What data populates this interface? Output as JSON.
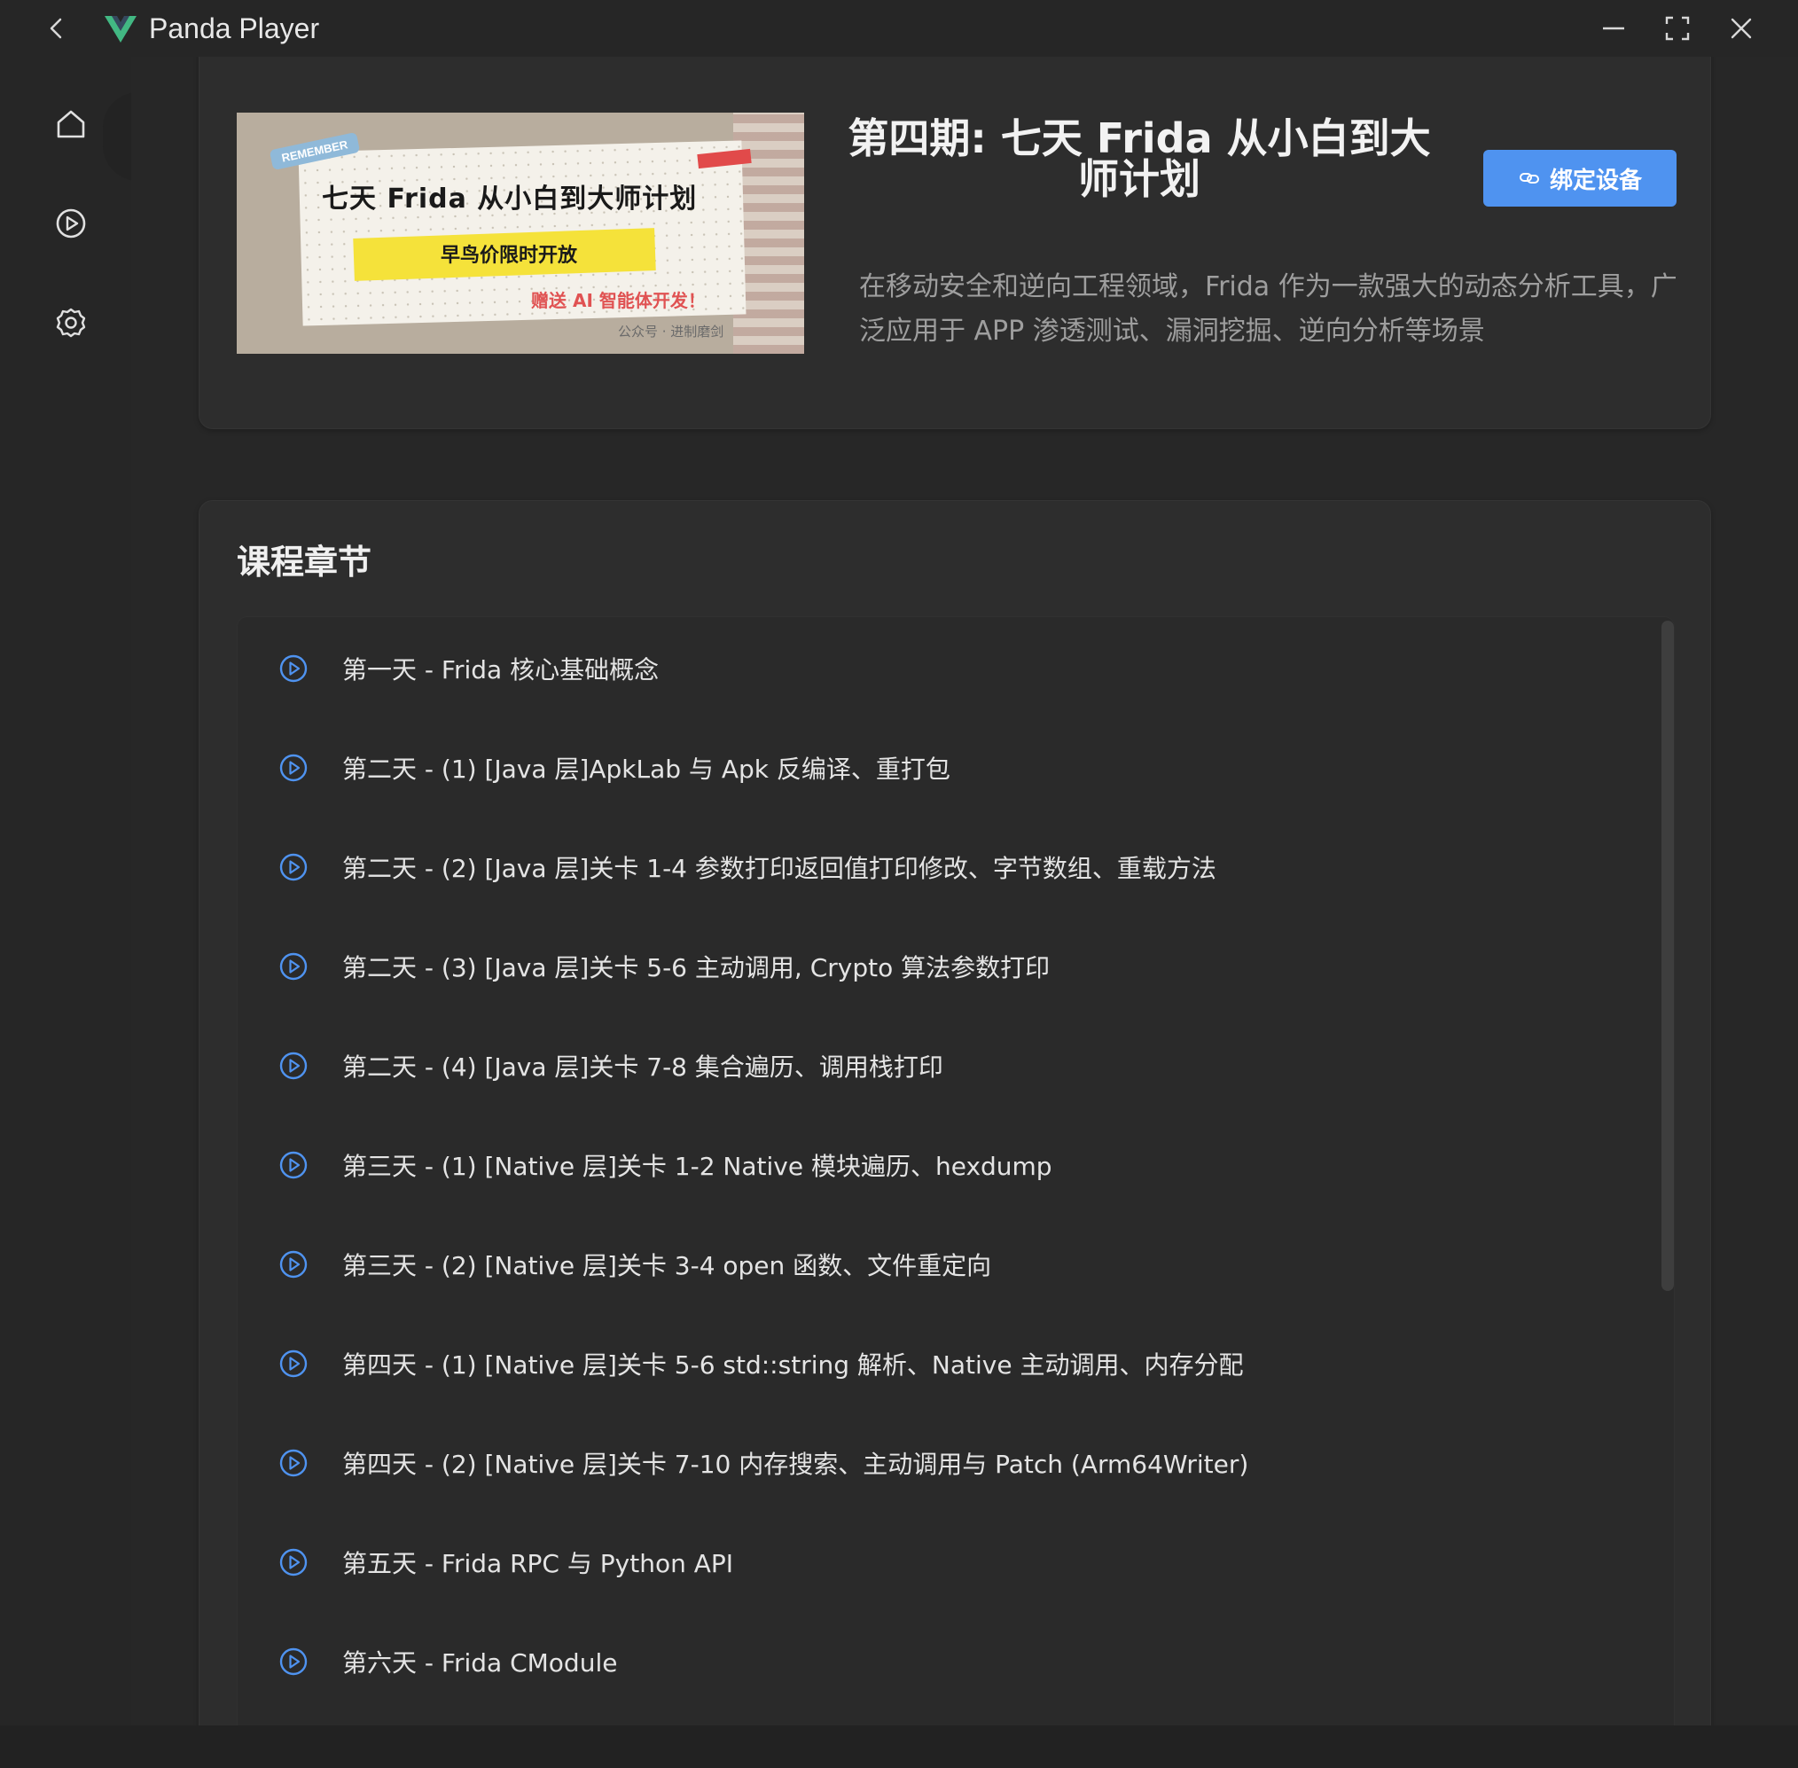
{
  "titlebar": {
    "app_title": "Panda Player",
    "logo_color": "#42b883",
    "back_icon": "chevron-left-icon",
    "minimize_icon": "minimize-icon",
    "maximize_icon": "fullscreen-icon",
    "close_icon": "close-icon"
  },
  "sidebar": {
    "items": [
      {
        "name": "home",
        "icon": "home-icon"
      },
      {
        "name": "player",
        "icon": "play-circle-icon"
      },
      {
        "name": "settings",
        "icon": "gear-icon"
      }
    ]
  },
  "course": {
    "cover": {
      "tag": "REMEMBER",
      "title": "七天 Frida 从小白到大师计划",
      "subtitle": "早鸟价限时开放",
      "gift": "赠送 AI 智能体开发！",
      "watermark": "公众号 · 进制磨剑"
    },
    "title": "第四期: 七天 Frida 从小白到大师计划",
    "bind_button": "绑定设备",
    "description": "在移动安全和逆向工程领域，Frida 作为一款强大的动态分析工具，广泛应用于 APP 渗透测试、漏洞挖掘、逆向分析等场景",
    "accent_color": "#4f93f0"
  },
  "chapters": {
    "heading": "课程章节",
    "items": [
      "第一天 - Frida 核心基础概念",
      "第二天 - (1) [Java 层]ApkLab 与 Apk 反编译、重打包",
      "第二天 - (2) [Java 层]关卡 1-4 参数打印返回值打印修改、字节数组、重载方法",
      "第二天 - (3) [Java 层]关卡 5-6 主动调用, Crypto 算法参数打印",
      "第二天 - (4) [Java 层]关卡 7-8 集合遍历、调用栈打印",
      "第三天 - (1) [Native 层]关卡 1-2 Native 模块遍历、hexdump",
      "第三天 - (2) [Native 层]关卡 3-4 open 函数、文件重定向",
      "第四天 - (1) [Native 层]关卡 5-6 std::string 解析、Native 主动调用、内存分配",
      "第四天 - (2) [Native 层]关卡 7-10 内存搜索、主动调用与 Patch (Arm64Writer)",
      "第五天 - Frida RPC 与 Python API",
      "第六天 - Frida CModule"
    ],
    "item_icon": "play-circle-icon"
  }
}
